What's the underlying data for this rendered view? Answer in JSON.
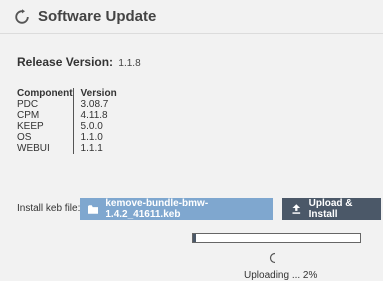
{
  "header": {
    "title": "Software Update",
    "icon": "refresh-icon"
  },
  "release": {
    "label": "Release Version:",
    "value": "1.1.8"
  },
  "components": {
    "headers": [
      "Component",
      "Version"
    ],
    "rows": [
      {
        "name": "PDC",
        "version": "3.08.7"
      },
      {
        "name": "CPM",
        "version": "4.11.8"
      },
      {
        "name": "KEEP",
        "version": "5.0.0"
      },
      {
        "name": "OS",
        "version": "1.1.0"
      },
      {
        "name": "WEBUI",
        "version": "1.1.1"
      }
    ]
  },
  "install": {
    "label": "Install keb file:",
    "file_name": "kemove-bundle-bmw-1.4.2_41611.keb",
    "file_icon": "folder-icon",
    "upload_label": "Upload & Install",
    "upload_icon": "upload-icon"
  },
  "progress": {
    "percent": 2,
    "status": "Uploading ... 2%"
  },
  "colors": {
    "background": "#f2f2f2",
    "file_button": "#7fa7cf",
    "upload_button": "#4b5868",
    "progress_fill": "#4b5868"
  }
}
